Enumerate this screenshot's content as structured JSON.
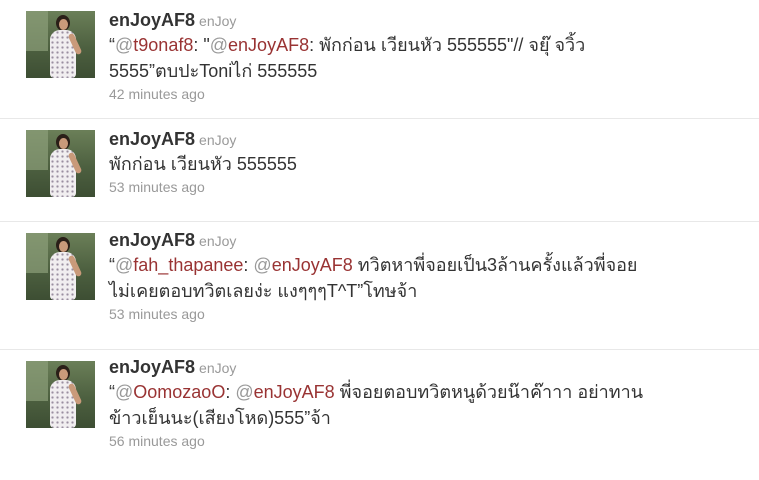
{
  "tweets": [
    {
      "screen_name": "enJoyAF8",
      "full_name": "enJoy",
      "line1": {
        "open_quote": "“",
        "m1_at": "@",
        "m1_name": "t9onaf8",
        "p1": ": \"",
        "m2_at": "@",
        "m2_name": "enJoyAF8",
        "p2": ": พักก่อน เวียนหัว 555555\"// จยุ๊ จวิ้ว"
      },
      "line2": "5555”ตบปะToniไก่ 555555",
      "time": "42 minutes ago"
    },
    {
      "screen_name": "enJoyAF8",
      "full_name": "enJoy",
      "line1": "พักก่อน เวียนหัว 555555",
      "time": "53 minutes ago"
    },
    {
      "screen_name": "enJoyAF8",
      "full_name": "enJoy",
      "line1": {
        "open_quote": "“",
        "m1_at": "@",
        "m1_name": "fah_thapanee",
        "p1": ": ",
        "m2_at": "@",
        "m2_name": "enJoyAF8",
        "p2": " ทวิตหาพี่จอยเป็น3ล้านครั้งแล้วพี่จอย"
      },
      "line2": "ไม่เคยตอบทวิตเลยง่ะ แงๆๆๆT^T”โทษจ้า",
      "time": "53 minutes ago"
    },
    {
      "screen_name": "enJoyAF8",
      "full_name": "enJoy",
      "line1": {
        "open_quote": "“",
        "m1_at": "@",
        "m1_name": "OomozaoO",
        "p1": ": ",
        "m2_at": "@",
        "m2_name": "enJoyAF8",
        "p2": " พี่จอยตอบทวิตหนูด้วยน๊าค๊าาา อย่าทาน"
      },
      "line2": "ข้าวเย็นนะ(เสียงโหด)555”จ้า",
      "time": "56 minutes ago"
    }
  ],
  "colors": {
    "text": "#333333",
    "meta": "#999999",
    "mention": "#993333",
    "divider": "#e8e8e8"
  }
}
